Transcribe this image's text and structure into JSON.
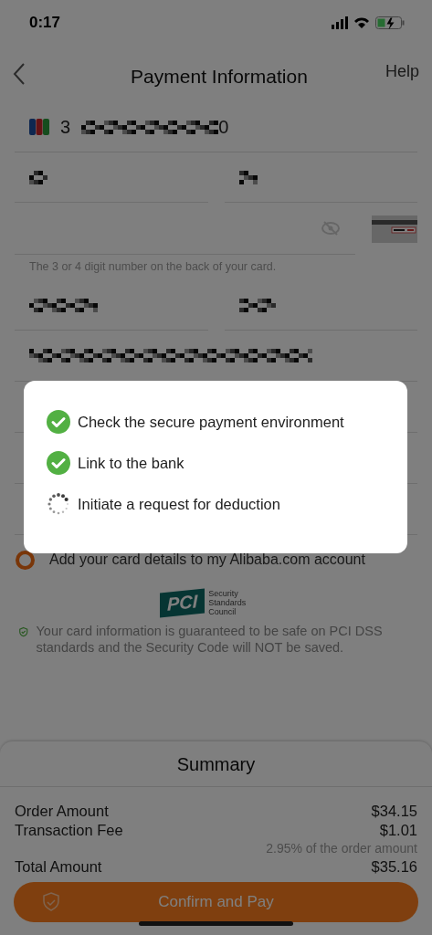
{
  "status_bar": {
    "time": "0:17"
  },
  "nav": {
    "title": "Payment Information",
    "help": "Help"
  },
  "fields": [
    {
      "kind": "card_number",
      "start": "3",
      "end": "0"
    },
    {
      "kind": "pair"
    },
    {
      "kind": "cvv",
      "hint": "The 3 or 4 digit number on the back of your card."
    },
    {
      "kind": "pair"
    },
    {
      "kind": "redacted"
    },
    {
      "kind": "empty"
    },
    {
      "kind": "empty"
    },
    {
      "kind": "empty"
    }
  ],
  "save_card": {
    "label": "Add your card details to my Alibaba.com account",
    "checked": false
  },
  "pci": {
    "mark": "PCI",
    "caption": "Security Standards Council",
    "note": "Your card information is guaranteed to be safe on PCI DSS standards and the Security Code will NOT be saved."
  },
  "summary": {
    "title": "Summary",
    "rows": [
      {
        "label": "Order Amount",
        "value": "$34.15"
      },
      {
        "label": "Transaction Fee",
        "value": "$1.01",
        "note": "2.95% of the order amount"
      },
      {
        "label": "Total Amount",
        "value": "$35.16"
      }
    ]
  },
  "confirm_button": "Confirm and Pay",
  "progress": {
    "steps": [
      {
        "label": "Check the secure payment environment",
        "done": true
      },
      {
        "label": "Link to the bank",
        "done": true
      },
      {
        "label": "Initiate a request for deduction",
        "done": false
      }
    ]
  }
}
